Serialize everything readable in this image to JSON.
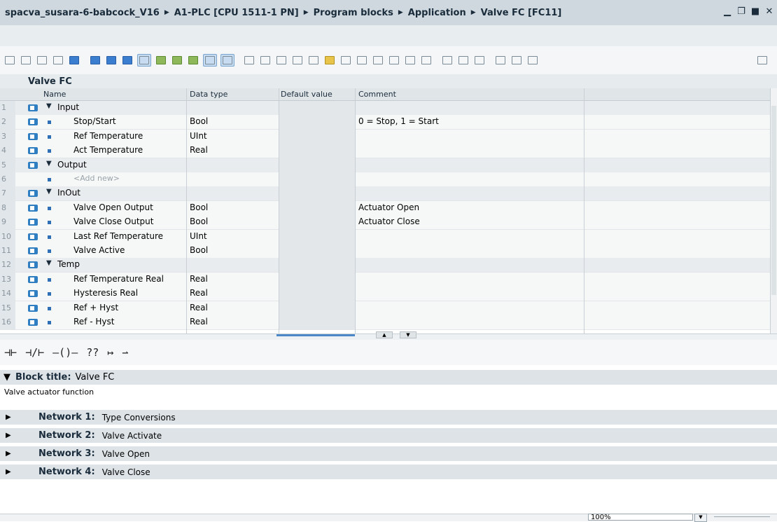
{
  "breadcrumb": [
    "spacva_susara-6-babcock_V16",
    "A1-PLC [CPU 1511-1 PN]",
    "Program blocks",
    "Application",
    "Valve FC [FC11]"
  ],
  "block_name": "Valve FC",
  "columns": {
    "name": "Name",
    "data_type": "Data type",
    "default_value": "Default value",
    "comment": "Comment"
  },
  "rows": [
    {
      "num": "1",
      "kind": "section",
      "name": "Input",
      "type": "",
      "comment": ""
    },
    {
      "num": "2",
      "kind": "var",
      "name": "Stop/Start",
      "type": "Bool",
      "comment": "0 = Stop, 1 = Start"
    },
    {
      "num": "3",
      "kind": "var",
      "name": "Ref Temperature",
      "type": "UInt",
      "comment": ""
    },
    {
      "num": "4",
      "kind": "var",
      "name": "Act Temperature",
      "type": "Real",
      "comment": ""
    },
    {
      "num": "5",
      "kind": "section",
      "name": "Output",
      "type": "",
      "comment": ""
    },
    {
      "num": "6",
      "kind": "add",
      "name": "<Add new>",
      "type": "",
      "comment": ""
    },
    {
      "num": "7",
      "kind": "section",
      "name": "InOut",
      "type": "",
      "comment": ""
    },
    {
      "num": "8",
      "kind": "var",
      "name": "Valve Open Output",
      "type": "Bool",
      "comment": "Actuator Open"
    },
    {
      "num": "9",
      "kind": "var",
      "name": "Valve Close Output",
      "type": "Bool",
      "comment": "Actuator Close"
    },
    {
      "num": "10",
      "kind": "var",
      "name": "Last Ref Temperature",
      "type": "UInt",
      "comment": ""
    },
    {
      "num": "11",
      "kind": "var",
      "name": "Valve Active",
      "type": "Bool",
      "comment": ""
    },
    {
      "num": "12",
      "kind": "section",
      "name": "Temp",
      "type": "",
      "comment": ""
    },
    {
      "num": "13",
      "kind": "var",
      "name": "Ref Temperature Real",
      "type": "Real",
      "comment": ""
    },
    {
      "num": "14",
      "kind": "var",
      "name": "Hysteresis Real",
      "type": "Real",
      "comment": ""
    },
    {
      "num": "15",
      "kind": "var",
      "name": "Ref + Hyst",
      "type": "Real",
      "comment": ""
    },
    {
      "num": "16",
      "kind": "var",
      "name": "Ref - Hyst",
      "type": "Real",
      "comment": ""
    }
  ],
  "lad_toolbar": [
    "⊣⊢",
    "⊣/⊢",
    "–()–",
    "??",
    "↦",
    "⇀"
  ],
  "block_title": {
    "label": "Block title:",
    "value": "Valve FC",
    "comment": "Valve actuator function"
  },
  "networks": [
    {
      "label": "Network 1:",
      "title": "Type Conversions"
    },
    {
      "label": "Network 2:",
      "title": "Valve Activate"
    },
    {
      "label": "Network 3:",
      "title": "Valve Open"
    },
    {
      "label": "Network 4:",
      "title": "Valve Close"
    }
  ],
  "zoom": "100%"
}
